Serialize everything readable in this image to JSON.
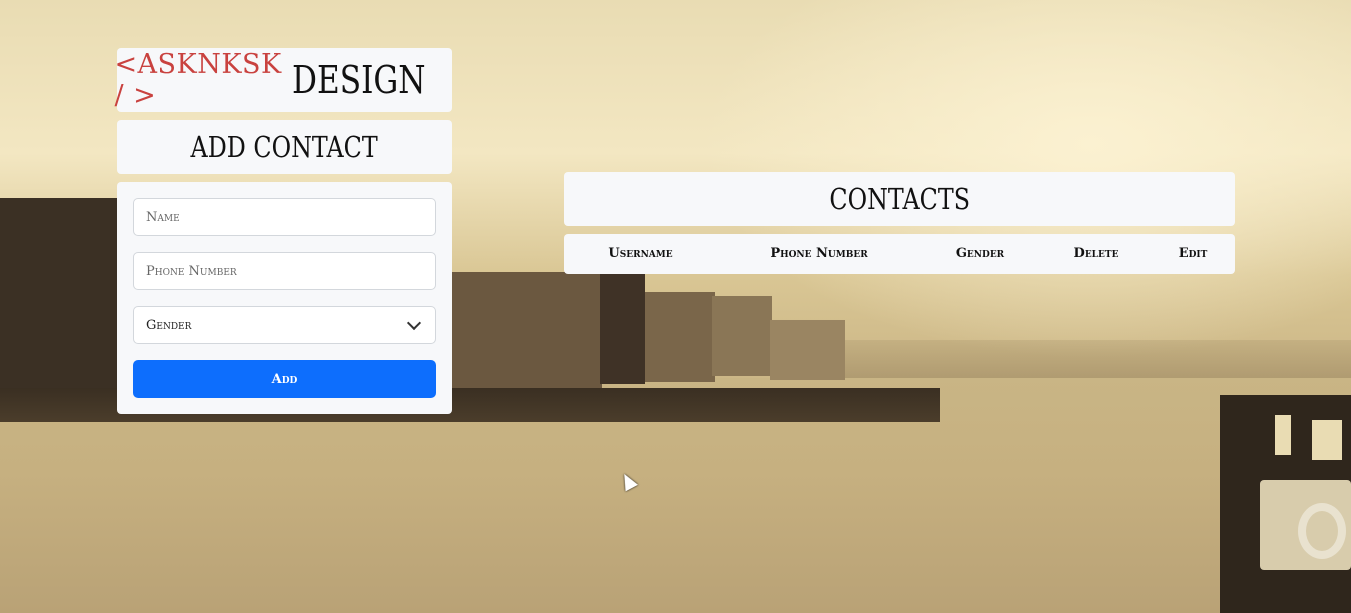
{
  "logo": {
    "left": "<ASKNKSK / >",
    "right": "DESIGN"
  },
  "add_contact": {
    "title": "ADD CONTACT",
    "name_placeholder": "Name",
    "phone_placeholder": "Phone Number",
    "gender_selected": "Gender",
    "gender_icon": "chevron-down-icon",
    "add_label": "Add"
  },
  "contacts": {
    "title": "CONTACTS",
    "columns": [
      "Username",
      "Phone Number",
      "Gender",
      "Delete",
      "Edit"
    ]
  },
  "colors": {
    "accent": "#0d6efd",
    "logo_red": "#c9423f",
    "card_bg": "#f7f8fa"
  }
}
